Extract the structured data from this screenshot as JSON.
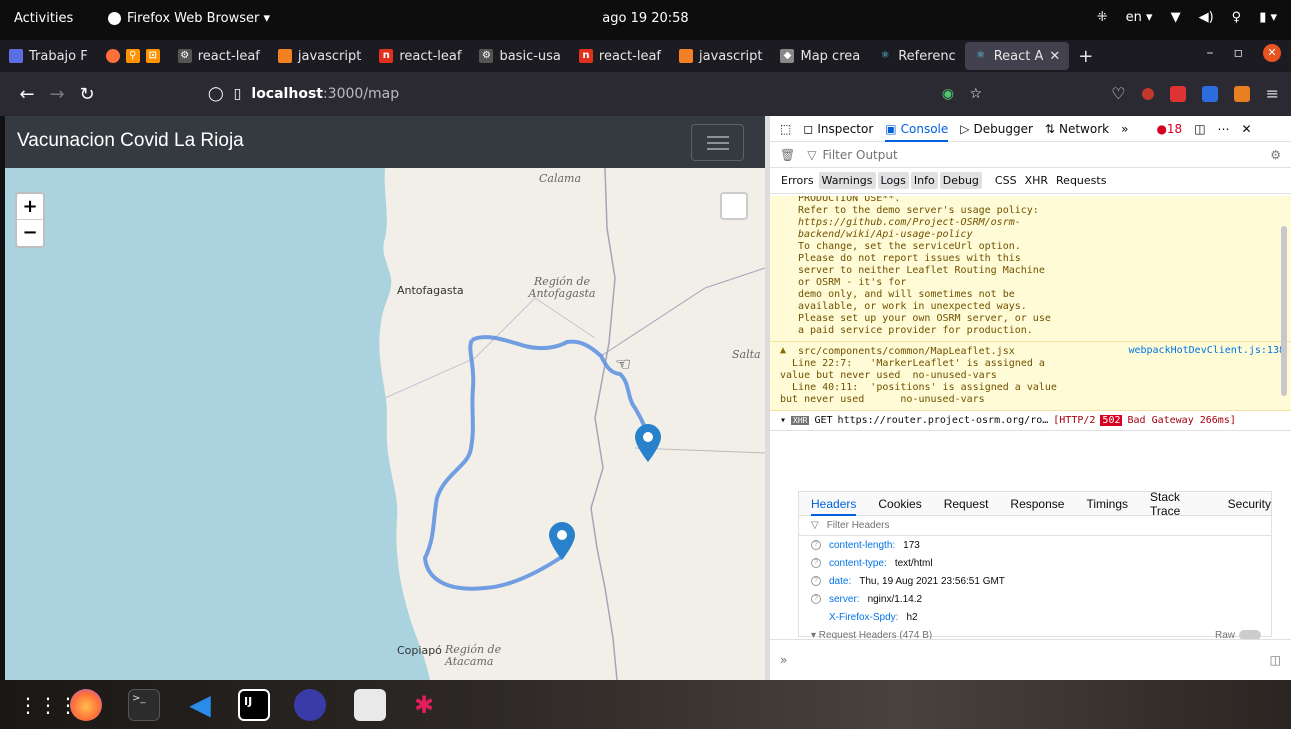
{
  "system": {
    "activities": "Activities",
    "app_menu": "Firefox Web Browser ▾",
    "clock": "ago 19 20:58",
    "lang": "en ▾"
  },
  "tabs": [
    {
      "label": "Trabajo F",
      "icon_color": "#5b6ee1"
    },
    {
      "label": "",
      "icon_color": "#ff9400"
    },
    {
      "label": "react-leaf",
      "icon_color": "#aaaaaa"
    },
    {
      "label": "javascript",
      "icon_color": "#f48024"
    },
    {
      "label": "react-leaf",
      "icon_color": "#e0311f"
    },
    {
      "label": "basic-usa",
      "icon_color": "#aaaaaa"
    },
    {
      "label": "react-leaf",
      "icon_color": "#e0311f"
    },
    {
      "label": "javascript",
      "icon_color": "#f48024"
    },
    {
      "label": "Map crea",
      "icon_color": "#cccccc"
    },
    {
      "label": "Referenc",
      "icon_color": "#61dafb"
    },
    {
      "label": "React A",
      "icon_color": "#61dafb",
      "active": true
    }
  ],
  "tab_new": "+",
  "url": {
    "host": "localhost",
    "path": ":3000/map"
  },
  "app": {
    "brand": "Vacunacion Covid La Rioja"
  },
  "map": {
    "zoom_in": "+",
    "zoom_out": "−",
    "labels": {
      "calama": "Calama",
      "antofagasta": "Antofagasta",
      "region_antofagasta": "Región de Antofagasta",
      "salta": "Salta",
      "copiapo": "Copiapó",
      "region_atacama": "Región de Atacama"
    },
    "route_color": "#5b8fe0",
    "marker_color": "#2a81cb"
  },
  "devtools": {
    "tabs": [
      "Inspector",
      "Console",
      "Debugger",
      "Network"
    ],
    "more": "»",
    "error_count": "18",
    "filter_placeholder": "Filter Output",
    "levels": [
      "Errors",
      "Warnings",
      "Logs",
      "Info",
      "Debug",
      "CSS",
      "XHR",
      "Requests"
    ],
    "message1": [
      "PRODUCTION USE**.",
      "Refer to the demo server's usage policy:",
      "https://github.com/Project-OSRM/osrm-",
      "backend/wiki/Api-usage-policy",
      "",
      "To change, set the serviceUrl option.",
      "",
      "Please do not report issues with this",
      "server to neither Leaflet Routing Machine",
      "or OSRM - it's for",
      "demo only, and will sometimes not be",
      "available, or work in unexpected ways.",
      "",
      "Please set up your own OSRM server, or use",
      "a paid service provider for production."
    ],
    "warn2_source": "webpackHotDevClient.js:138",
    "message2": [
      "src/components/common/MapLeaflet.jsx",
      "  Line 22:7:   'MarkerLeaflet' is assigned a",
      "value but never used  no-unused-vars",
      "  Line 40:11:  'positions' is assigned a value",
      "but never used      no-unused-vars"
    ],
    "xhr": {
      "tag": "XHR",
      "method": "GET",
      "url": "https://router.project-osrm.org/ro…",
      "proto": "[HTTP/2",
      "status": "502",
      "status_text": "Bad Gateway 266ms]"
    },
    "net_tabs": [
      "Headers",
      "Cookies",
      "Request",
      "Response",
      "Timings",
      "Stack Trace",
      "Security"
    ],
    "filter_headers": "Filter Headers",
    "headers": [
      {
        "k": "content-length:",
        "v": "173"
      },
      {
        "k": "content-type:",
        "v": "text/html"
      },
      {
        "k": "date:",
        "v": "Thu, 19 Aug 2021 23:56:51 GMT"
      },
      {
        "k": "server:",
        "v": "nginx/1.14.2"
      },
      {
        "k": "X-Firefox-Spdy:",
        "v": "h2"
      }
    ],
    "req_headers": "▾ Request Headers (474 B)",
    "raw": "Raw",
    "prompt": "»"
  }
}
